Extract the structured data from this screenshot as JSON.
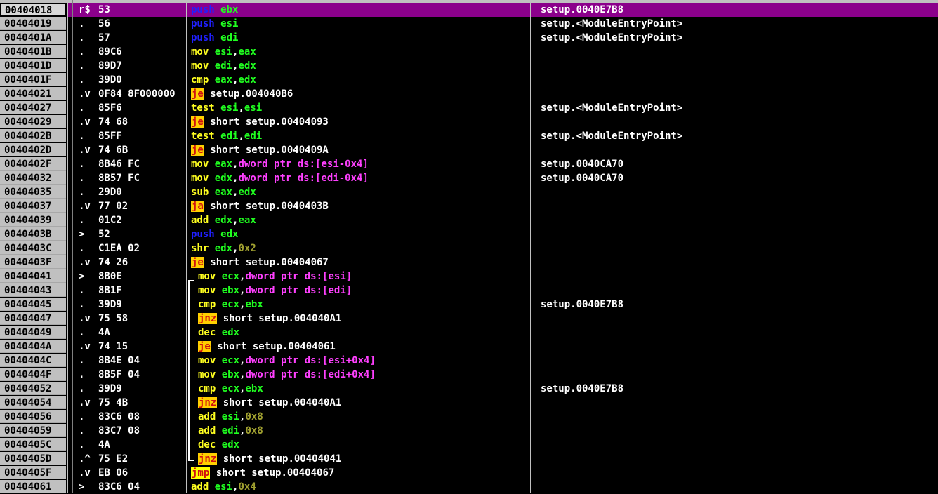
{
  "rows": [
    {
      "addr": "00404018",
      "mark": "r$",
      "bytes": "53",
      "mn": "push",
      "ops": "ebx",
      "comment": "setup.0040E7B8",
      "sel": true
    },
    {
      "addr": "00404019",
      "mark": ".",
      "bytes": "56",
      "mn": "push",
      "ops": "esi",
      "comment": "setup.<ModuleEntryPoint>"
    },
    {
      "addr": "0040401A",
      "mark": ".",
      "bytes": "57",
      "mn": "push",
      "ops": "edi",
      "comment": "setup.<ModuleEntryPoint>"
    },
    {
      "addr": "0040401B",
      "mark": ".",
      "bytes": "89C6",
      "mn": "mov",
      "ops": "esi,eax",
      "comment": ""
    },
    {
      "addr": "0040401D",
      "mark": ".",
      "bytes": "89D7",
      "mn": "mov",
      "ops": "edi,edx",
      "comment": ""
    },
    {
      "addr": "0040401F",
      "mark": ".",
      "bytes": "39D0",
      "mn": "cmp",
      "ops": "eax,edx",
      "comment": ""
    },
    {
      "addr": "00404021",
      "mark": ".v",
      "bytes": "0F84 8F000000",
      "mn": "je",
      "ops": "setup.004040B6",
      "comment": ""
    },
    {
      "addr": "00404027",
      "mark": ".",
      "bytes": "85F6",
      "mn": "test",
      "ops": "esi,esi",
      "comment": "setup.<ModuleEntryPoint>"
    },
    {
      "addr": "00404029",
      "mark": ".v",
      "bytes": "74 68",
      "mn": "je",
      "ops": "short setup.00404093",
      "comment": ""
    },
    {
      "addr": "0040402B",
      "mark": ".",
      "bytes": "85FF",
      "mn": "test",
      "ops": "edi,edi",
      "comment": "setup.<ModuleEntryPoint>"
    },
    {
      "addr": "0040402D",
      "mark": ".v",
      "bytes": "74 6B",
      "mn": "je",
      "ops": "short setup.0040409A",
      "comment": ""
    },
    {
      "addr": "0040402F",
      "mark": ".",
      "bytes": "8B46 FC",
      "mn": "mov",
      "ops": "eax,dword ptr ds:[esi-0x4]",
      "comment": "setup.0040CA70"
    },
    {
      "addr": "00404032",
      "mark": ".",
      "bytes": "8B57 FC",
      "mn": "mov",
      "ops": "edx,dword ptr ds:[edi-0x4]",
      "comment": "setup.0040CA70"
    },
    {
      "addr": "00404035",
      "mark": ".",
      "bytes": "29D0",
      "mn": "sub",
      "ops": "eax,edx",
      "comment": ""
    },
    {
      "addr": "00404037",
      "mark": ".v",
      "bytes": "77 02",
      "mn": "ja",
      "ops": "short setup.0040403B",
      "comment": ""
    },
    {
      "addr": "00404039",
      "mark": ".",
      "bytes": "01C2",
      "mn": "add",
      "ops": "edx,eax",
      "comment": ""
    },
    {
      "addr": "0040403B",
      "mark": ">",
      "bytes": "52",
      "mn": "push",
      "ops": "edx",
      "comment": ""
    },
    {
      "addr": "0040403C",
      "mark": ".",
      "bytes": "C1EA 02",
      "mn": "shr",
      "ops": "edx,0x2",
      "comment": ""
    },
    {
      "addr": "0040403F",
      "mark": ".v",
      "bytes": "74 26",
      "mn": "je",
      "ops": "short setup.00404067",
      "comment": ""
    },
    {
      "addr": "00404041",
      "mark": ">",
      "bytes": "8B0E",
      "mn": "mov",
      "ops": "ecx,dword ptr ds:[esi]",
      "comment": ""
    },
    {
      "addr": "00404043",
      "mark": ".",
      "bytes": "8B1F",
      "mn": "mov",
      "ops": "ebx,dword ptr ds:[edi]",
      "comment": ""
    },
    {
      "addr": "00404045",
      "mark": ".",
      "bytes": "39D9",
      "mn": "cmp",
      "ops": "ecx,ebx",
      "comment": "setup.0040E7B8"
    },
    {
      "addr": "00404047",
      "mark": ".v",
      "bytes": "75 58",
      "mn": "jnz",
      "ops": "short setup.004040A1",
      "comment": ""
    },
    {
      "addr": "00404049",
      "mark": ".",
      "bytes": "4A",
      "mn": "dec",
      "ops": "edx",
      "comment": ""
    },
    {
      "addr": "0040404A",
      "mark": ".v",
      "bytes": "74 15",
      "mn": "je",
      "ops": "short setup.00404061",
      "comment": ""
    },
    {
      "addr": "0040404C",
      "mark": ".",
      "bytes": "8B4E 04",
      "mn": "mov",
      "ops": "ecx,dword ptr ds:[esi+0x4]",
      "comment": ""
    },
    {
      "addr": "0040404F",
      "mark": ".",
      "bytes": "8B5F 04",
      "mn": "mov",
      "ops": "ebx,dword ptr ds:[edi+0x4]",
      "comment": ""
    },
    {
      "addr": "00404052",
      "mark": ".",
      "bytes": "39D9",
      "mn": "cmp",
      "ops": "ecx,ebx",
      "comment": "setup.0040E7B8"
    },
    {
      "addr": "00404054",
      "mark": ".v",
      "bytes": "75 4B",
      "mn": "jnz",
      "ops": "short setup.004040A1",
      "comment": ""
    },
    {
      "addr": "00404056",
      "mark": ".",
      "bytes": "83C6 08",
      "mn": "add",
      "ops": "esi,0x8",
      "comment": ""
    },
    {
      "addr": "00404059",
      "mark": ".",
      "bytes": "83C7 08",
      "mn": "add",
      "ops": "edi,0x8",
      "comment": ""
    },
    {
      "addr": "0040405C",
      "mark": ".",
      "bytes": "4A",
      "mn": "dec",
      "ops": "edx",
      "comment": ""
    },
    {
      "addr": "0040405D",
      "mark": ".^",
      "bytes": "75 E2",
      "mn": "jnz",
      "ops": "short setup.00404041",
      "comment": ""
    },
    {
      "addr": "0040405F",
      "mark": ".v",
      "bytes": "EB 06",
      "mn": "jmp",
      "ops": "short setup.00404067",
      "comment": ""
    },
    {
      "addr": "00404061",
      "mark": ">",
      "bytes": "83C6 04",
      "mn": "add",
      "ops": "esi,0x4",
      "comment": ""
    }
  ]
}
